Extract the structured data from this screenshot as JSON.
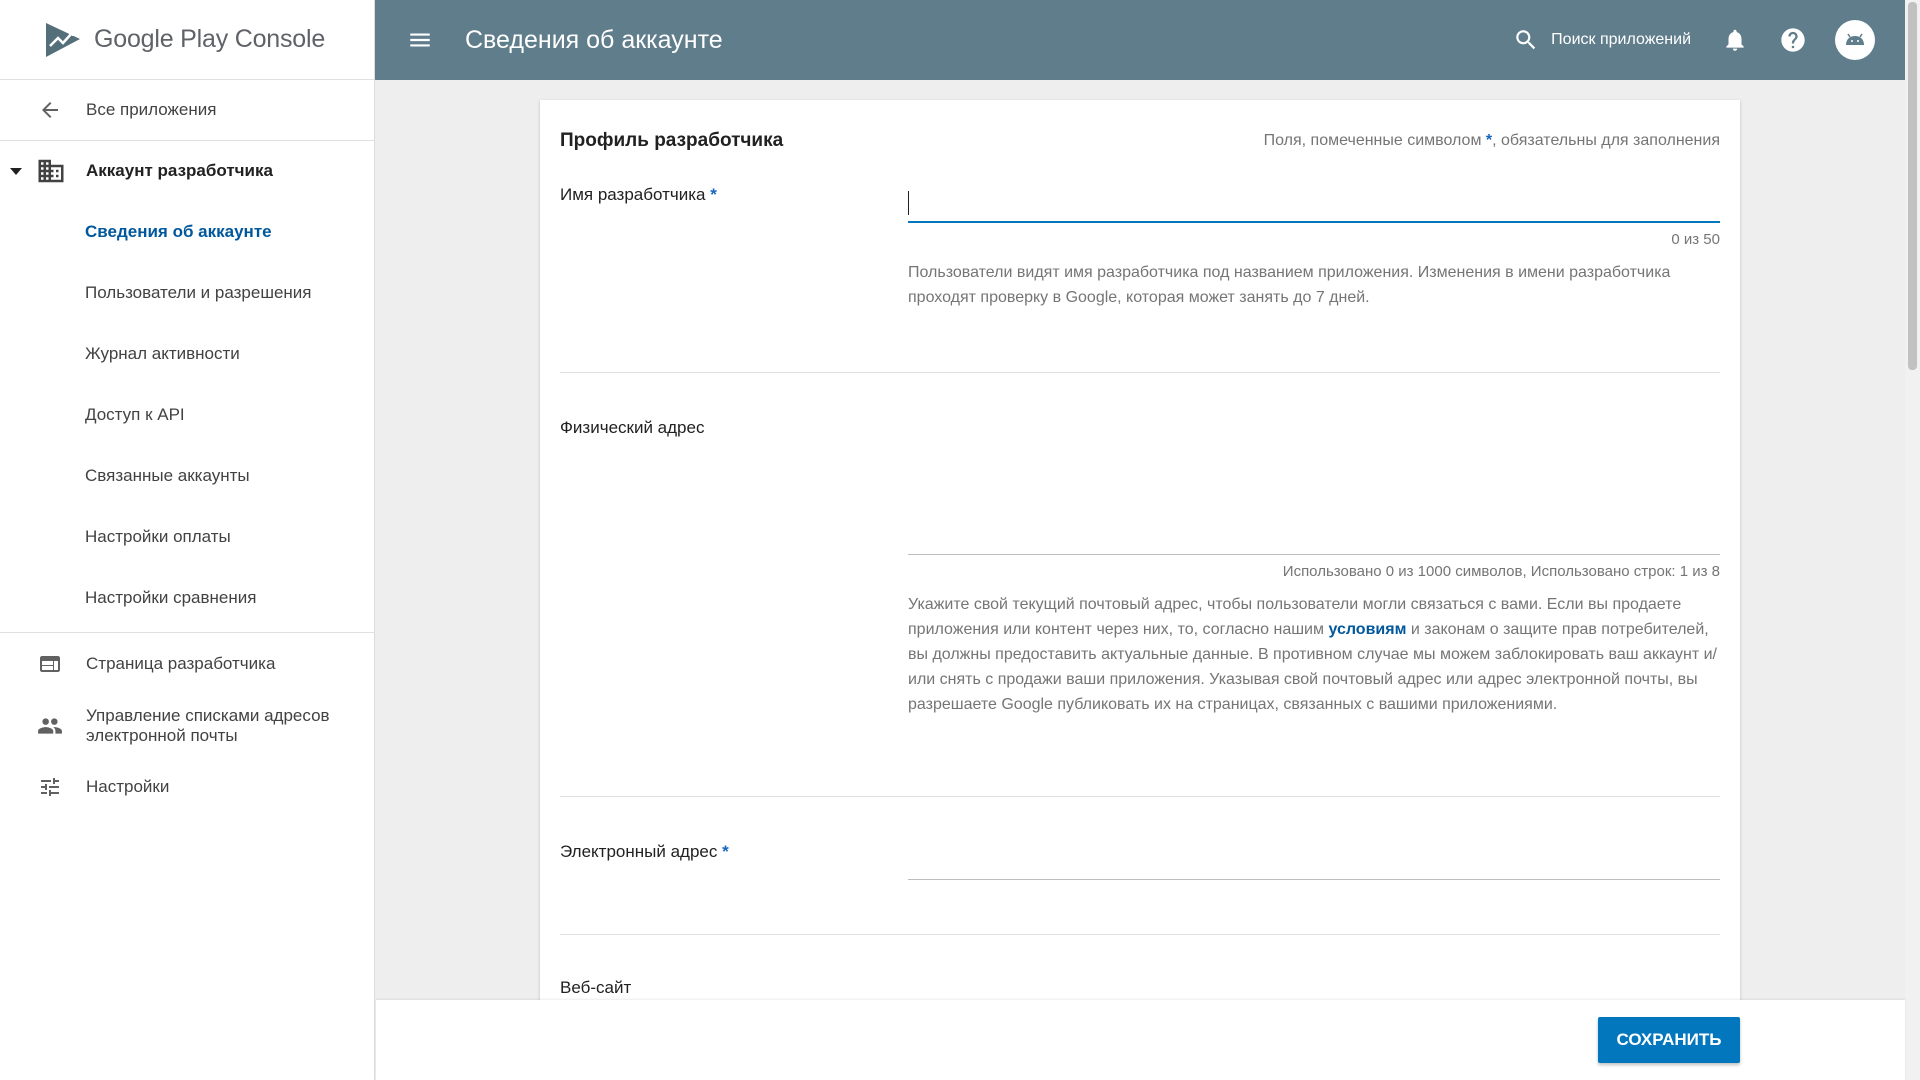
{
  "logo": {
    "brand": "Google Play",
    "product": "Console"
  },
  "sidebar": {
    "back_label": "Все приложения",
    "section_label": "Аккаунт разработчика",
    "sub_items": [
      {
        "label": "Сведения об аккаунте",
        "active": true
      },
      {
        "label": "Пользователи и разрешения"
      },
      {
        "label": "Журнал активности"
      },
      {
        "label": "Доступ к API"
      },
      {
        "label": "Связанные аккаунты"
      },
      {
        "label": "Настройки оплаты"
      },
      {
        "label": "Настройки сравнения"
      }
    ],
    "top_items": [
      {
        "label": "Страница разработчика",
        "icon": "web-page-icon"
      },
      {
        "label": "Управление списками адресов электронной почты",
        "icon": "people-icon"
      },
      {
        "label": "Настройки",
        "icon": "tune-icon"
      }
    ]
  },
  "topbar": {
    "title": "Сведения об аккаунте",
    "search_placeholder": "Поиск приложений"
  },
  "card": {
    "title": "Профиль разработчика",
    "required_note_before": "Поля, помеченные символом",
    "required_note_star": "*",
    "required_note_after": ", обязательны для заполнения",
    "developer_name": {
      "label": "Имя разработчика",
      "star": "*",
      "value": "",
      "counter": "0 из 50",
      "help": "Пользователи видят имя разработчика под названием приложения. Изменения в имени разработчика проходят проверку в Google, которая может занять до 7 дней."
    },
    "address": {
      "label": "Физический адрес",
      "value": "",
      "counter": "Использовано 0 из 1000 символов, Использовано строк: 1 из 8",
      "help_before": "Укажите свой текущий почтовый адрес, чтобы пользователи могли связаться с вами. Если вы продаете приложения или контент через них, то, согласно нашим ",
      "help_link": "условиям",
      "help_after": " и законам о защите прав потребителей, вы должны предоставить актуальные данные. В противном случае мы можем заблокировать ваш аккаунт и/или снять с продажи ваши приложения. Указывая свой почтовый адрес или адрес электронной почты, вы разрешаете Google публиковать их на страницах, связанных с вашими приложениями."
    },
    "email": {
      "label": "Электронный адрес",
      "star": "*",
      "value": ""
    },
    "website": {
      "label": "Веб-сайт"
    }
  },
  "bottombar": {
    "save_label": "СОХРАНИТЬ"
  },
  "colors": {
    "topbar": "#607d8b",
    "accent": "#0277bd",
    "active_nav": "#01579b"
  }
}
